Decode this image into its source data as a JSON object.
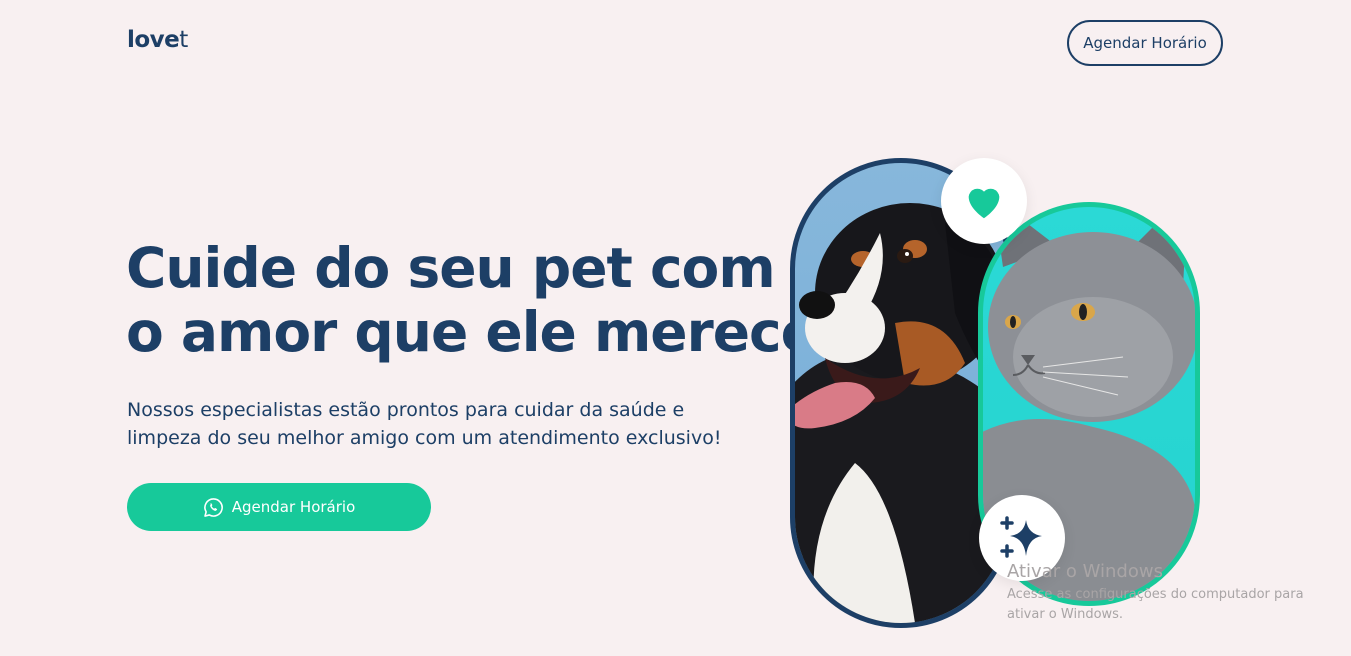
{
  "header": {
    "logo_main": "love",
    "logo_tail": "t",
    "cta_label": "Agendar Horário"
  },
  "hero": {
    "title_line1": "Cuide do seu pet com",
    "title_line2": "o amor que ele merece",
    "subtitle_line1": "Nossos especialistas estão prontos para cuidar da saúde e",
    "subtitle_line2": "limpeza do seu melhor amigo com um atendimento exclusivo!",
    "cta_label": "Agendar Horário",
    "cta_icon": "whatsapp-icon"
  },
  "art": {
    "dog_frame_color": "#1d3f66",
    "cat_frame_color": "#17c99a",
    "badge_top_icon": "heart-icon",
    "badge_bottom_icon": "sparkle-icon"
  },
  "watermark": {
    "title": "Ativar o Windows",
    "text_line1": "Acesse as configurações do computador para",
    "text_line2": "ativar o Windows."
  },
  "colors": {
    "background": "#f8f0f1",
    "primary": "#1d3f66",
    "accent": "#17c99a",
    "cat_bg": "#2bd9d6",
    "dog_bg": "#87b7db"
  }
}
